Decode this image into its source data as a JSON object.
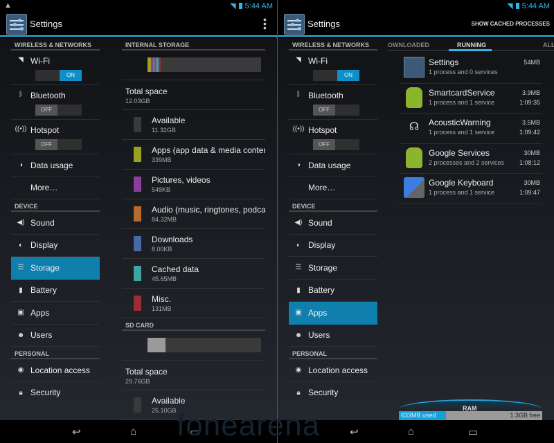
{
  "status": {
    "time": "5:44 AM",
    "warning_icon": "warning-icon",
    "wifi_icon": "wifi-icon",
    "battery_icon": "battery-icon"
  },
  "actionbar": {
    "title": "Settings",
    "overflow_icon": "overflow-menu-icon",
    "show_cached": "SHOW CACHED PROCESSES"
  },
  "sidebar": {
    "wireless_header": "WIRELESS & NETWORKS",
    "toggles": [
      {
        "label": "Wi-Fi",
        "icon": "wifi-icon",
        "state": "ON"
      },
      {
        "label": "Bluetooth",
        "icon": "bluetooth-icon",
        "state": "OFF"
      },
      {
        "label": "Hotspot",
        "icon": "hotspot-icon",
        "state": "OFF"
      }
    ],
    "wireless_items": [
      {
        "label": "Data usage",
        "icon": "data-usage-icon"
      },
      {
        "label": "More…",
        "icon": ""
      }
    ],
    "device_header": "DEVICE",
    "device_items": [
      {
        "label": "Sound",
        "icon": "sound-icon"
      },
      {
        "label": "Display",
        "icon": "display-icon"
      },
      {
        "label": "Storage",
        "icon": "storage-icon"
      },
      {
        "label": "Battery",
        "icon": "battery-icon"
      },
      {
        "label": "Apps",
        "icon": "apps-icon"
      },
      {
        "label": "Users",
        "icon": "users-icon"
      }
    ],
    "personal_header": "PERSONAL",
    "personal_items": [
      {
        "label": "Location access",
        "icon": "location-icon"
      },
      {
        "label": "Security",
        "icon": "lock-icon"
      }
    ],
    "selected_left": "Storage",
    "selected_right": "Apps"
  },
  "storage": {
    "internal_header": "INTERNAL STORAGE",
    "internal_total_label": "Total space",
    "internal_total": "12.03GB",
    "internal_rows": [
      {
        "label": "Available",
        "size": "11.32GB",
        "color": "#3a3a3a"
      },
      {
        "label": "Apps (app data & media content)",
        "size": "339MB",
        "color": "#99a21f"
      },
      {
        "label": "Pictures, videos",
        "size": "548KB",
        "color": "#8a3f9a"
      },
      {
        "label": "Audio (music, ringtones, podcasts, etc.)",
        "size": "84.32MB",
        "color": "#b66a2d"
      },
      {
        "label": "Downloads",
        "size": "8.00KB",
        "color": "#4a67a8"
      },
      {
        "label": "Cached data",
        "size": "45.65MB",
        "color": "#3fa3a0"
      },
      {
        "label": "Misc.",
        "size": "131MB",
        "color": "#9a2f2f"
      }
    ],
    "internal_bar": [
      {
        "color": "#99a21f",
        "fraction": 0.028
      },
      {
        "color": "#8a3f9a",
        "fraction": 0.018
      },
      {
        "color": "#b66a2d",
        "fraction": 0.018
      },
      {
        "color": "#4a67a8",
        "fraction": 0.018
      },
      {
        "color": "#3fa3a0",
        "fraction": 0.018
      },
      {
        "color": "#9a2f2f",
        "fraction": 0.018
      }
    ],
    "sd_header": "SD CARD",
    "sd_total_label": "Total space",
    "sd_total": "29.76GB",
    "sd_used_fraction": 0.157,
    "sd_rows": [
      {
        "label": "Available",
        "size": "25.10GB",
        "color": "#3a3a3a"
      }
    ]
  },
  "apps": {
    "tabs": [
      "OWNLOADED",
      "RUNNING",
      "ALL"
    ],
    "active_tab": "RUNNING",
    "processes": [
      {
        "name": "Settings",
        "desc": "1 process and 0 services",
        "size": "54MB",
        "time": "",
        "icon": "settings-icon"
      },
      {
        "name": "SmartcardService",
        "desc": "1 process and 1 service",
        "size": "3.9MB",
        "time": "1:09:35",
        "icon": "android-icon"
      },
      {
        "name": "AcousticWarning",
        "desc": "1 process and 1 service",
        "size": "3.5MB",
        "time": "1:09:42",
        "icon": "headset-icon"
      },
      {
        "name": "Google Services",
        "desc": "2 processes and 2 services",
        "size": "30MB",
        "time": "1:08:12",
        "icon": "android-icon"
      },
      {
        "name": "Google Keyboard",
        "desc": "1 process and 1 service",
        "size": "30MB",
        "time": "1:09:47",
        "icon": "keyboard-icon"
      }
    ],
    "ram": {
      "label": "RAM",
      "used": "633MB used",
      "free": "1.3GB free",
      "used_fraction": 0.33
    }
  },
  "nav": {
    "back": "back-icon",
    "home": "home-icon",
    "recents": "recents-icon"
  },
  "watermark": "fonearena"
}
